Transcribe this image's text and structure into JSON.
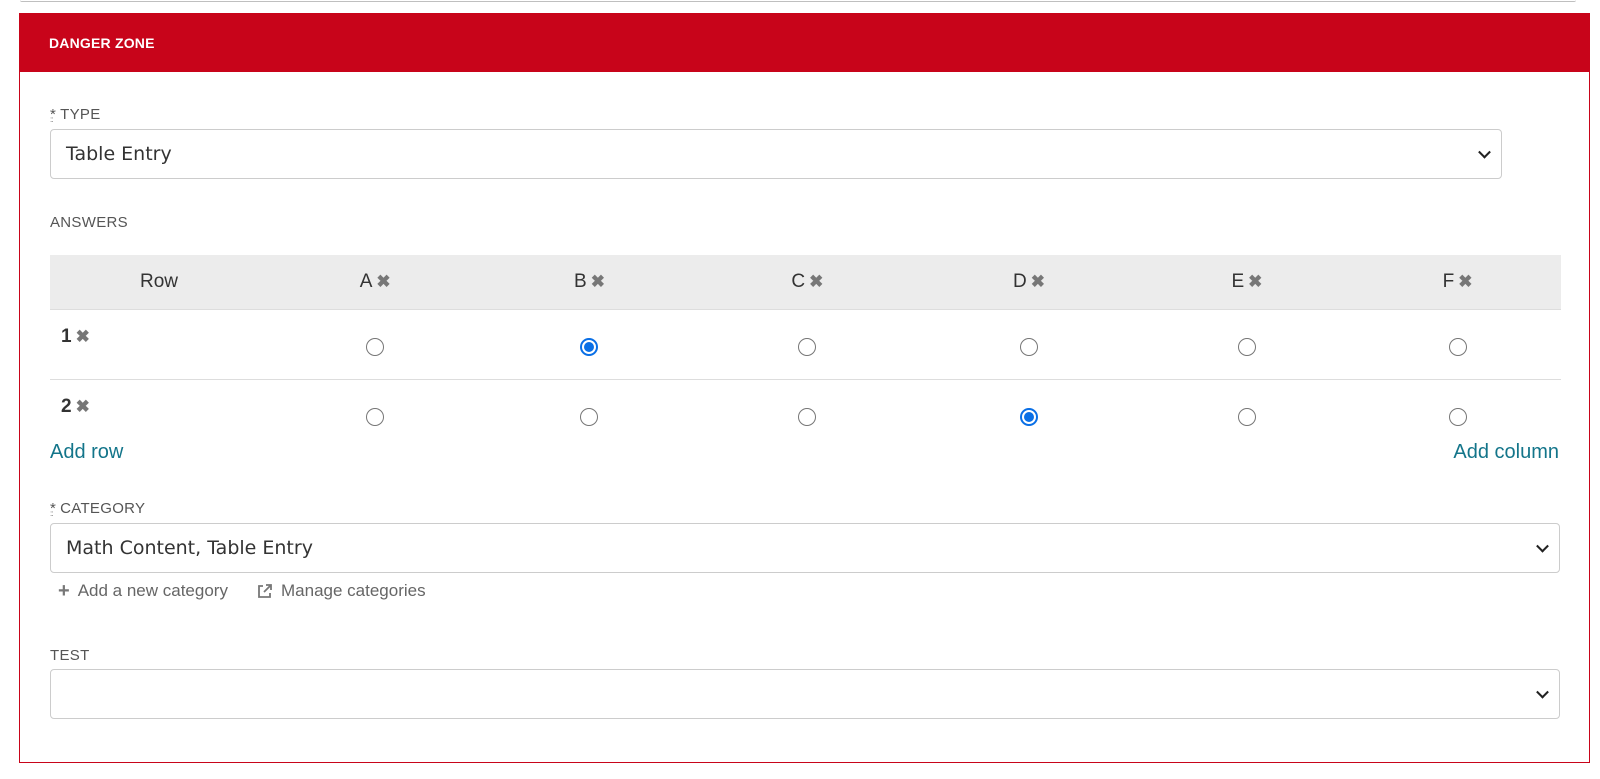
{
  "panel": {
    "title": "DANGER ZONE",
    "accent_color": "#c8041a"
  },
  "type_field": {
    "required_mark": "*",
    "label": "TYPE",
    "value": "Table Entry"
  },
  "answers": {
    "label": "ANSWERS",
    "row_header": "Row",
    "columns": [
      "A",
      "B",
      "C",
      "D",
      "E",
      "F"
    ],
    "rows": [
      {
        "label": "1",
        "selected": "B"
      },
      {
        "label": "2",
        "selected": "D"
      }
    ],
    "add_row": "Add row",
    "add_column": "Add column",
    "remove_icon": "close-icon",
    "radio_color": "#0a6fe6"
  },
  "category_field": {
    "required_mark": "*",
    "label": "CATEGORY",
    "value": "Math Content, Table Entry",
    "add_new": "Add a new category",
    "manage": "Manage categories"
  },
  "test_field": {
    "label": "TEST",
    "value": ""
  }
}
